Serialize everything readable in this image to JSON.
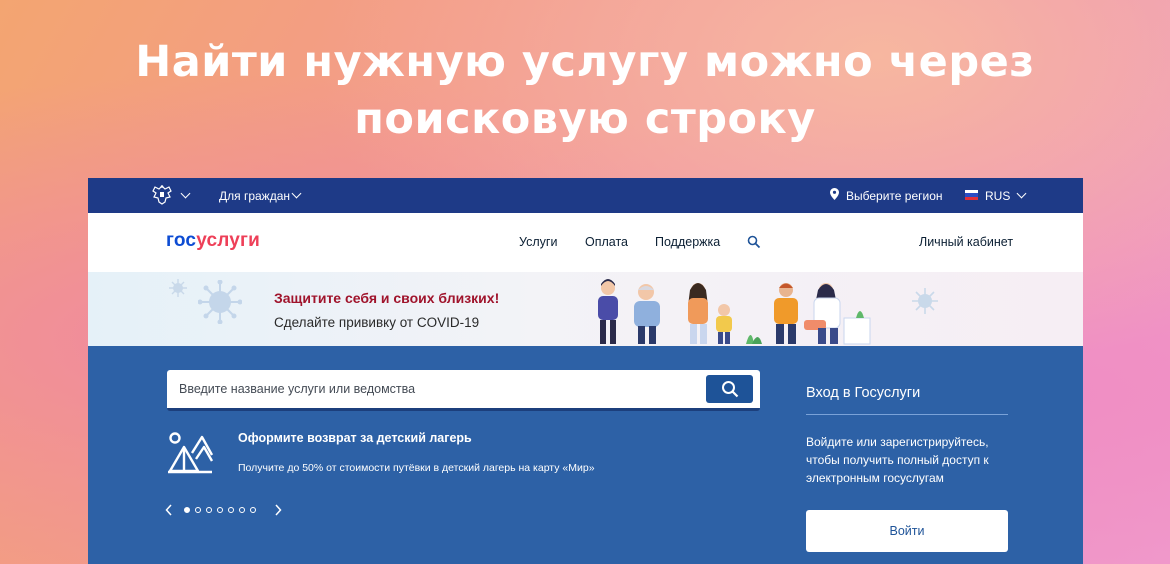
{
  "headline": "Найти нужную услугу можно через поисковую строку",
  "topbar": {
    "citizens_label": "Для граждан",
    "region_label": "Выберите регион",
    "language": "RUS"
  },
  "nav": {
    "logo_part1": "гос",
    "logo_part2": "услуги",
    "services": "Услуги",
    "payment": "Оплата",
    "support": "Поддержка",
    "cabinet": "Личный кабинет"
  },
  "banner": {
    "title": "Защитите себя и своих близких!",
    "subtitle": "Сделайте прививку от COVID-19"
  },
  "search": {
    "placeholder": "Введите название услуги или ведомства"
  },
  "promo": {
    "title": "Оформите возврат за детский лагерь",
    "text": "Получите до 50% от стоимости путёвки в детский лагерь на карту «Мир»",
    "slides_total": 7,
    "active_slide": 1
  },
  "login": {
    "title": "Вход в Госуслуги",
    "text": "Войдите или зарегистрируйтесь, чтобы получить полный доступ к электронным госуслугам",
    "button": "Войти"
  },
  "colors": {
    "topbar": "#1e3a87",
    "main": "#2d61a6",
    "logo_blue": "#0d4cd3",
    "logo_red": "#ee3f58",
    "banner_title": "#a0142c"
  }
}
